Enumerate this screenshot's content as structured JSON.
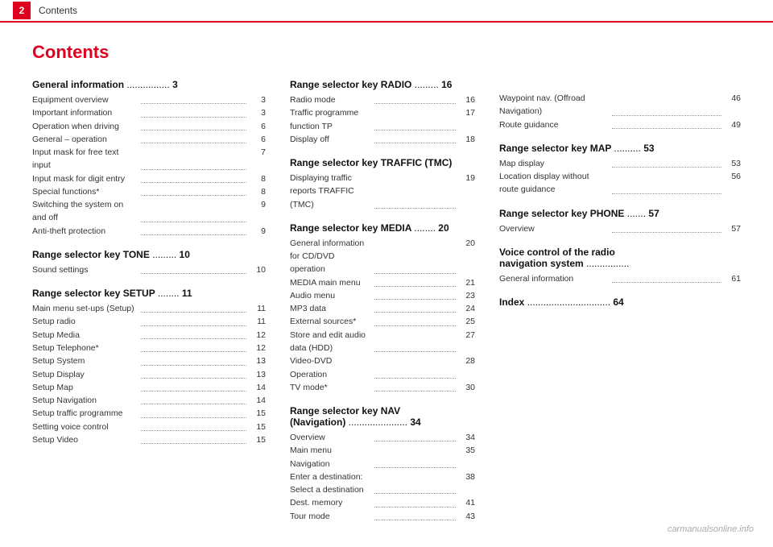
{
  "topbar": {
    "number": "2",
    "title": "Contents"
  },
  "page_title": "Contents",
  "col_left": {
    "sections": [
      {
        "id": "general-information",
        "heading": "General information",
        "heading_dots": "................",
        "heading_page": "3",
        "entries": [
          {
            "text": "Equipment overview",
            "dots": true,
            "page": "3"
          },
          {
            "text": "Important information",
            "dots": true,
            "page": "3"
          },
          {
            "text": "Operation when driving",
            "dots": true,
            "page": "6"
          },
          {
            "text": "General – operation",
            "dots": true,
            "page": "6"
          },
          {
            "text": "Input mask for free text input",
            "dots": true,
            "page": "7"
          },
          {
            "text": "Input mask for digit entry",
            "dots": true,
            "page": "8"
          },
          {
            "text": "Special functions*",
            "dots": true,
            "page": "8"
          },
          {
            "text": "Switching the system on and off",
            "dots": true,
            "page": "9"
          },
          {
            "text": "Anti-theft protection",
            "dots": true,
            "page": "9"
          }
        ]
      },
      {
        "id": "range-selector-tone",
        "heading": "Range selector key TONE",
        "heading_dots": ".........",
        "heading_page": "10",
        "entries": [
          {
            "text": "Sound settings",
            "dots": true,
            "page": "10"
          }
        ]
      },
      {
        "id": "range-selector-setup",
        "heading": "Range selector key SETUP",
        "heading_dots": "........",
        "heading_page": "11",
        "entries": [
          {
            "text": "Main menu set-ups (Setup)",
            "dots": true,
            "page": "11"
          },
          {
            "text": "Setup radio",
            "dots": true,
            "page": "11"
          },
          {
            "text": "Setup Media",
            "dots": true,
            "page": "12"
          },
          {
            "text": "Setup Telephone*",
            "dots": true,
            "page": "12"
          },
          {
            "text": "Setup System",
            "dots": true,
            "page": "13"
          },
          {
            "text": "Setup Display",
            "dots": true,
            "page": "13"
          },
          {
            "text": "Setup Map",
            "dots": true,
            "page": "14"
          },
          {
            "text": "Setup Navigation",
            "dots": true,
            "page": "14"
          },
          {
            "text": "Setup traffic programme",
            "dots": true,
            "page": "15"
          },
          {
            "text": "Setting voice control",
            "dots": true,
            "page": "15"
          },
          {
            "text": "Setup Video",
            "dots": true,
            "page": "15"
          }
        ]
      }
    ]
  },
  "col_right": {
    "col_a": {
      "sections": [
        {
          "id": "range-selector-radio",
          "heading": "Range selector key RADIO",
          "heading_dots": ".........",
          "heading_page": "16",
          "entries": [
            {
              "text": "Radio mode",
              "dots": true,
              "page": "16"
            },
            {
              "text": "Traffic programme function TP",
              "dots": true,
              "page": "17"
            },
            {
              "text": "Display off",
              "dots": true,
              "page": "18"
            }
          ]
        },
        {
          "id": "range-selector-traffic",
          "heading": "Range selector key TRAFFIC (TMC)",
          "heading_page": "",
          "entries": [
            {
              "text": "Displaying traffic reports TRAFFIC (TMC)",
              "dots": true,
              "page": "19"
            }
          ]
        },
        {
          "id": "range-selector-media",
          "heading": "Range selector key MEDIA",
          "heading_dots": "........",
          "heading_page": "20",
          "entries": [
            {
              "text": "General information for CD/DVD operation",
              "dots": true,
              "page": "20"
            },
            {
              "text": "MEDIA main menu",
              "dots": true,
              "page": "21"
            },
            {
              "text": "Audio menu",
              "dots": true,
              "page": "23"
            },
            {
              "text": "MP3 data",
              "dots": true,
              "page": "24"
            },
            {
              "text": "External sources*",
              "dots": true,
              "page": "25"
            },
            {
              "text": "Store and edit audio data (HDD)",
              "dots": true,
              "page": "27"
            },
            {
              "text": "Video-DVD Operation",
              "dots": true,
              "page": "28"
            },
            {
              "text": "TV mode*",
              "dots": true,
              "page": "30"
            }
          ]
        },
        {
          "id": "range-selector-nav",
          "heading": "Range selector key NAV (Navigation)",
          "heading_dots": "......................",
          "heading_page": "34",
          "entries": [
            {
              "text": "Overview",
              "dots": true,
              "page": "34"
            },
            {
              "text": "Main menu Navigation",
              "dots": true,
              "page": "35"
            },
            {
              "text": "Enter a destination: Select a destination",
              "dots": true,
              "page": "38"
            },
            {
              "text": "Dest. memory",
              "dots": true,
              "page": "41"
            },
            {
              "text": "Tour mode",
              "dots": true,
              "page": "43"
            }
          ]
        }
      ]
    },
    "col_b": {
      "sections": [
        {
          "id": "range-selector-map",
          "heading": "Range selector key MAP",
          "heading_dots": "..........",
          "heading_page": "53",
          "entries": [
            {
              "text": "Map display",
              "dots": true,
              "page": "53"
            },
            {
              "text": "Location display without route guidance",
              "dots": true,
              "page": "56"
            }
          ]
        },
        {
          "id": "range-selector-phone",
          "heading": "Range selector key PHONE",
          "heading_dots": ".......",
          "heading_page": "57",
          "entries": [
            {
              "text": "Overview",
              "dots": true,
              "page": "57"
            }
          ]
        },
        {
          "id": "voice-control-radio",
          "heading": "Voice control of the radio navigation system",
          "heading_dots": "................",
          "heading_page": "",
          "entries": [
            {
              "text": "General information",
              "dots": true,
              "page": "61"
            }
          ]
        },
        {
          "id": "index",
          "heading": "Index",
          "heading_dots": "...............................",
          "heading_page": "64",
          "entries": []
        }
      ],
      "waypoint_entry": {
        "text": "Waypoint nav. (Offroad Navigation)",
        "dots": true,
        "page": "46"
      },
      "route_guidance_entry": {
        "text": "Route guidance",
        "dots": true,
        "page": "49"
      }
    }
  },
  "watermark": "carmanualsonline.info"
}
